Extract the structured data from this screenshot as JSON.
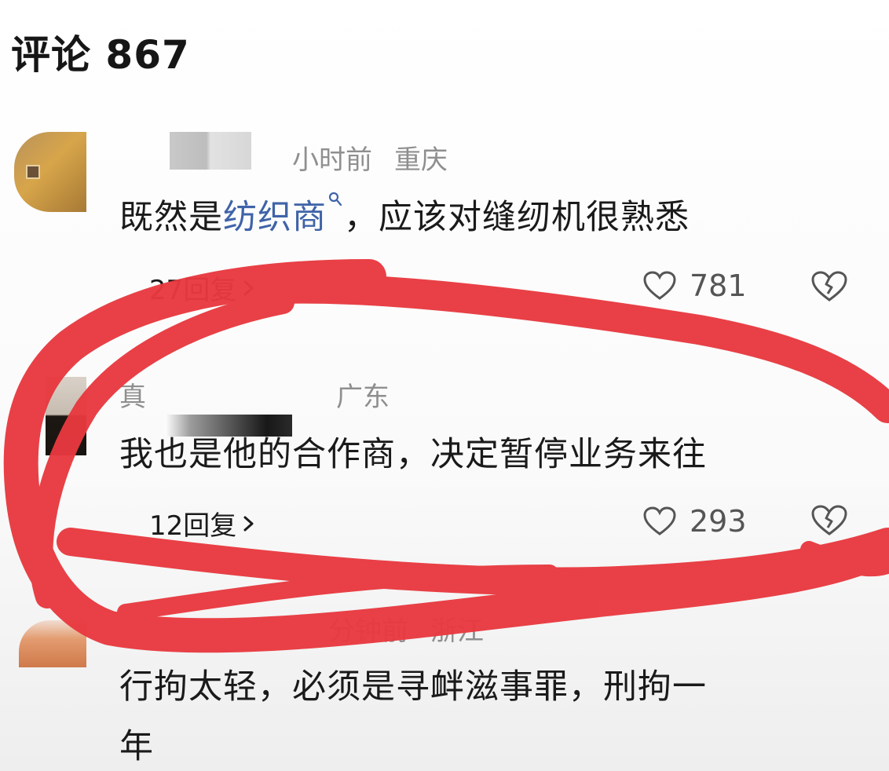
{
  "header": {
    "title": "评论 867"
  },
  "comments": [
    {
      "username": "",
      "meta_time": "小时前",
      "meta_location": "重庆",
      "text_before": "既然是",
      "text_link": "纺织商",
      "text_after": "，应该对缝纫机很熟悉",
      "replies": "27回复",
      "likes": "781"
    },
    {
      "username": "真",
      "meta_time": "",
      "meta_location": "广东",
      "text_before": "我也是他的合作商，决定暂停业务来往",
      "replies": "12回复",
      "likes": "293"
    },
    {
      "username": "",
      "meta_time": "分钟前",
      "meta_location": "浙江",
      "text_line1": "行拘太轻，必须是寻衅滋事罪，刑拘一",
      "text_line2": "年"
    }
  ],
  "icons": {
    "like": "heart-outline-icon",
    "dislike": "broken-heart-icon",
    "chevron": "chevron-right-icon",
    "search": "search-icon"
  },
  "colors": {
    "highlight_ink": "#e8393f",
    "link": "#3f63a8"
  }
}
